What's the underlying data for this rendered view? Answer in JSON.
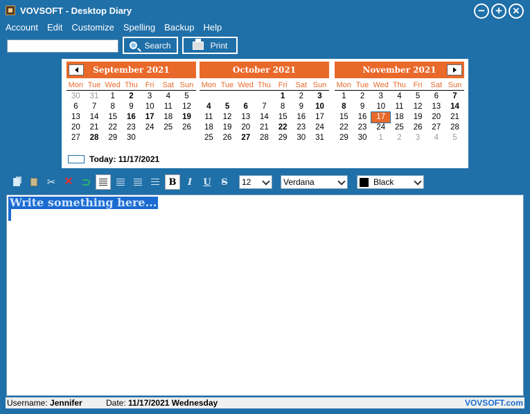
{
  "window": {
    "title": "VOVSOFT - Desktop Diary",
    "min_glyph": "−",
    "max_glyph": "+",
    "close_glyph": "×"
  },
  "menu": [
    "Account",
    "Edit",
    "Customize",
    "Spelling",
    "Backup",
    "Help"
  ],
  "toolbar": {
    "search_value": "",
    "search_label": "Search",
    "print_label": "Print"
  },
  "calendar": {
    "weekdays": [
      "Mon",
      "Tue",
      "Wed",
      "Thu",
      "Fri",
      "Sat",
      "Sun"
    ],
    "today_label": "Today: 11/17/2021",
    "months": [
      {
        "title": "September 2021",
        "days": [
          {
            "d": "30",
            "o": 1
          },
          {
            "d": "31",
            "o": 1
          },
          {
            "d": "1"
          },
          {
            "d": "2",
            "b": 1
          },
          {
            "d": "3"
          },
          {
            "d": "4"
          },
          {
            "d": "5"
          },
          {
            "d": "6"
          },
          {
            "d": "7"
          },
          {
            "d": "8"
          },
          {
            "d": "9"
          },
          {
            "d": "10"
          },
          {
            "d": "11"
          },
          {
            "d": "12"
          },
          {
            "d": "13"
          },
          {
            "d": "14"
          },
          {
            "d": "15"
          },
          {
            "d": "16",
            "b": 1
          },
          {
            "d": "17",
            "b": 1
          },
          {
            "d": "18"
          },
          {
            "d": "19",
            "b": 1
          },
          {
            "d": "20"
          },
          {
            "d": "21"
          },
          {
            "d": "22"
          },
          {
            "d": "23"
          },
          {
            "d": "24"
          },
          {
            "d": "25"
          },
          {
            "d": "26"
          },
          {
            "d": "27"
          },
          {
            "d": "28",
            "b": 1
          },
          {
            "d": "29"
          },
          {
            "d": "30"
          }
        ]
      },
      {
        "title": "October 2021",
        "days": [
          {
            "d": ""
          },
          {
            "d": ""
          },
          {
            "d": ""
          },
          {
            "d": ""
          },
          {
            "d": "1",
            "b": 1
          },
          {
            "d": "2"
          },
          {
            "d": "3",
            "b": 1
          },
          {
            "d": "4",
            "b": 1
          },
          {
            "d": "5",
            "b": 1
          },
          {
            "d": "6",
            "b": 1
          },
          {
            "d": "7"
          },
          {
            "d": "8"
          },
          {
            "d": "9"
          },
          {
            "d": "10",
            "b": 1
          },
          {
            "d": "11"
          },
          {
            "d": "12"
          },
          {
            "d": "13"
          },
          {
            "d": "14"
          },
          {
            "d": "15"
          },
          {
            "d": "16"
          },
          {
            "d": "17"
          },
          {
            "d": "18"
          },
          {
            "d": "19"
          },
          {
            "d": "20"
          },
          {
            "d": "21"
          },
          {
            "d": "22",
            "b": 1
          },
          {
            "d": "23"
          },
          {
            "d": "24"
          },
          {
            "d": "25"
          },
          {
            "d": "26"
          },
          {
            "d": "27",
            "b": 1
          },
          {
            "d": "28"
          },
          {
            "d": "29"
          },
          {
            "d": "30"
          },
          {
            "d": "31"
          }
        ]
      },
      {
        "title": "November 2021",
        "days": [
          {
            "d": "1"
          },
          {
            "d": "2"
          },
          {
            "d": "3"
          },
          {
            "d": "4"
          },
          {
            "d": "5"
          },
          {
            "d": "6"
          },
          {
            "d": "7",
            "b": 1
          },
          {
            "d": "8",
            "b": 1
          },
          {
            "d": "9"
          },
          {
            "d": "10"
          },
          {
            "d": "11"
          },
          {
            "d": "12"
          },
          {
            "d": "13"
          },
          {
            "d": "14",
            "b": 1
          },
          {
            "d": "15"
          },
          {
            "d": "16"
          },
          {
            "d": "17",
            "t": 1
          },
          {
            "d": "18"
          },
          {
            "d": "19"
          },
          {
            "d": "20"
          },
          {
            "d": "21"
          },
          {
            "d": "22"
          },
          {
            "d": "23"
          },
          {
            "d": "24"
          },
          {
            "d": "25"
          },
          {
            "d": "26"
          },
          {
            "d": "27"
          },
          {
            "d": "28"
          },
          {
            "d": "29"
          },
          {
            "d": "30"
          },
          {
            "d": "1",
            "o": 1
          },
          {
            "d": "2",
            "o": 1
          },
          {
            "d": "3",
            "o": 1
          },
          {
            "d": "4",
            "o": 1
          },
          {
            "d": "5",
            "o": 1
          }
        ]
      }
    ]
  },
  "format": {
    "bold_glyph": "B",
    "italic_glyph": "I",
    "underline_glyph": "U",
    "strike_glyph": "S",
    "font_size": "12",
    "font_name": "Verdana",
    "color_name": "Black"
  },
  "editor": {
    "text": "Write something here..."
  },
  "status": {
    "username_label": "Username:",
    "username": "Jennifer",
    "date_label": "Date:",
    "date": "11/17/2021 Wednesday",
    "brand": "VOVSOFT.com"
  },
  "colors": {
    "background": "#1f6fa8",
    "accent": "#e8692a",
    "selection": "#1a6bd0"
  }
}
